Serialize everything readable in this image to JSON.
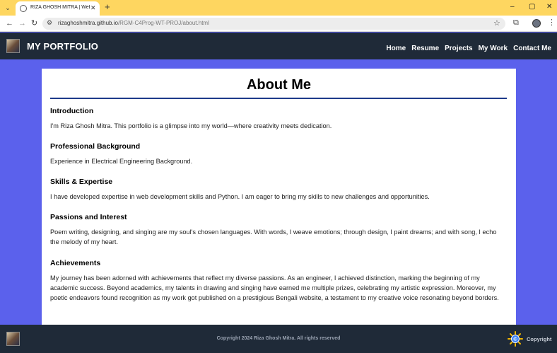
{
  "browser": {
    "tab_title": "RIZA GHOSH MITRA | Web Tech",
    "url_host": "rizaghoshmitra.github.io",
    "url_path": "/RGM-C4Prog-WT-PROJ/about.html"
  },
  "header": {
    "brand": "MY PORTFOLIO",
    "nav": [
      "Home",
      "Resume",
      "Projects",
      "My Work",
      "Contact Me"
    ]
  },
  "main": {
    "title": "About Me",
    "sections": [
      {
        "heading": "Introduction",
        "body": "I'm Riza Ghosh Mitra. This portfolio is a glimpse into my world—where creativity meets dedication."
      },
      {
        "heading": "Professional Background",
        "body": "Experience in Electrical Engineering Background."
      },
      {
        "heading": "Skills & Expertise",
        "body": "I have developed expertise in web development skills and Python. I am eager to bring my skills to new challenges and opportunities."
      },
      {
        "heading": "Passions and Interest",
        "body": "Poem writing, designing, and singing are my soul's chosen languages. With words, I weave emotions; through design, I paint dreams; and with song, I echo the melody of my heart."
      },
      {
        "heading": "Achievements",
        "body": "My journey has been adorned with achievements that reflect my diverse passions. As an engineer, I achieved distinction, marking the beginning of my academic success. Beyond academics, my talents in drawing and singing have earned me multiple prizes, celebrating my artistic expression. Moreover, my poetic endeavors found recognition as my work got published on a prestigious Bengali website, a testament to my creative voice resonating beyond borders."
      }
    ]
  },
  "footer": {
    "copyright_text": "Copyright 2024 Riza Ghosh Mitra. All rights reserved",
    "badge_label": "Copyright"
  },
  "colors": {
    "page_background": "#5b61ec",
    "header_background": "#1f2a38",
    "title_rule": "#1e3a8a",
    "tabstrip": "#fed660"
  }
}
